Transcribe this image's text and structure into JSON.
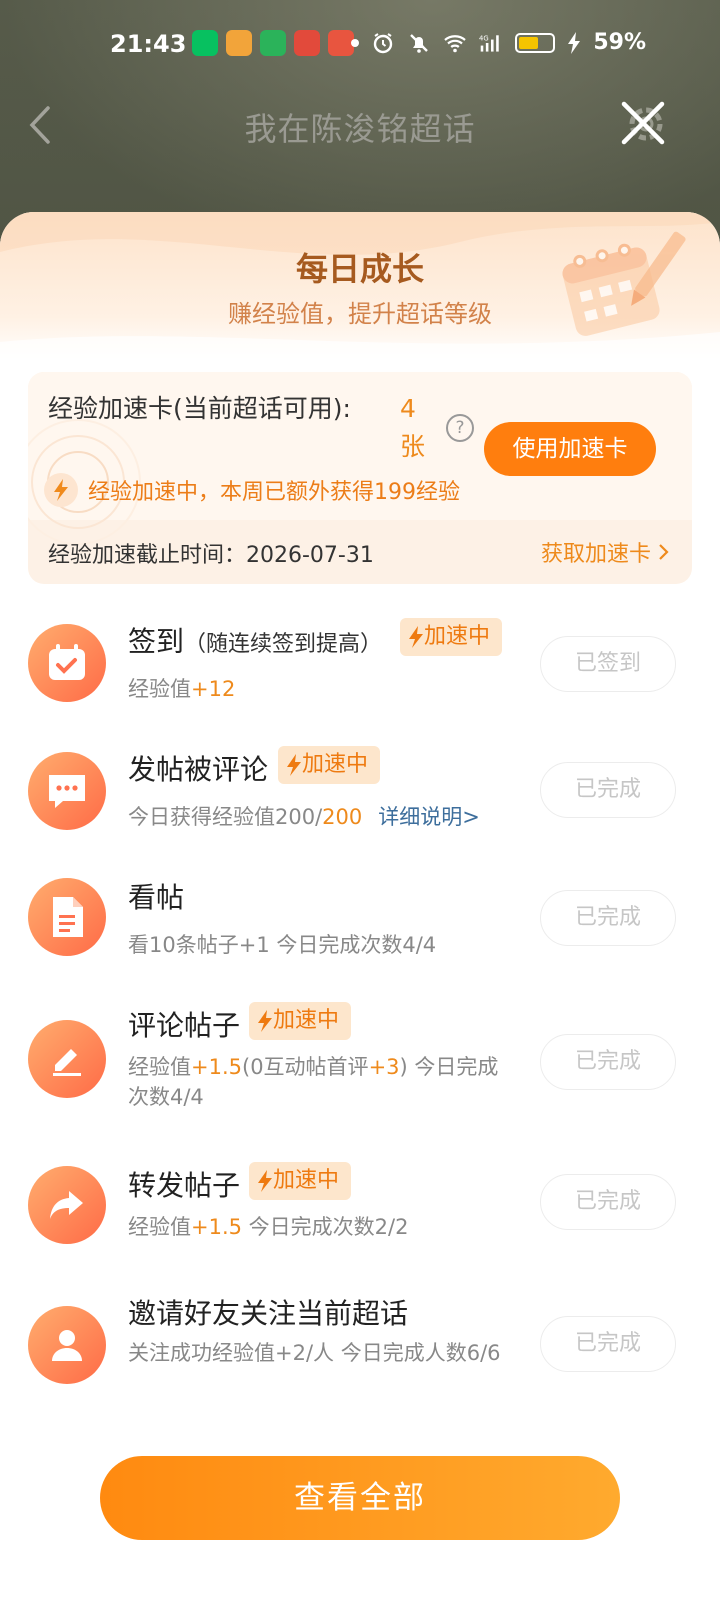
{
  "status_bar": {
    "time": "21:43",
    "battery": "59%",
    "battery_level": 0.59,
    "app_icon_colors": [
      "#07c160",
      "#f2a43a",
      "#2bb35a",
      "#e24a3b",
      "#e8553f"
    ]
  },
  "header": {
    "title": "我在陈浚铭超话"
  },
  "growth": {
    "title": "每日成长",
    "subtitle": "赚经验值，提升超话等级"
  },
  "boost_card": {
    "label": "经验加速卡(当前超话可用):",
    "count": "4张",
    "help_icon": "?",
    "use_button": "使用加速卡",
    "status_text": "经验加速中，本周已额外获得199经验",
    "deadline_text": "经验加速截止时间：2026-07-31",
    "get_card_link": "获取加速卡",
    "accent": "#ff7e0e"
  },
  "tasks": [
    {
      "icon": "calendar-check-icon",
      "title": "签到",
      "title_sub": "（随连续签到提高）",
      "tag": "加速中",
      "desc_prefix": "经验值",
      "desc_hl": "+12",
      "button": "已签到"
    },
    {
      "icon": "comment-icon",
      "title": "发帖被评论",
      "tag": "加速中",
      "desc_prefix": "今日获得经验值200/",
      "desc_hl": "200",
      "desc_link": "详细说明>",
      "button": "已完成"
    },
    {
      "icon": "document-icon",
      "title": "看帖",
      "desc": "看10条帖子+1   今日完成次数4/4",
      "button": "已完成"
    },
    {
      "icon": "pencil-icon",
      "title": "评论帖子",
      "tag": "加速中",
      "desc_prefix": "经验值",
      "desc_hl": "+1.5",
      "desc_mid": "(0互动帖首评",
      "desc_hl2": "+3",
      "desc_suffix": ")   今日完成次数4/4",
      "button": "已完成"
    },
    {
      "icon": "share-arrow-icon",
      "title": "转发帖子",
      "tag": "加速中",
      "desc_prefix": "经验值",
      "desc_hl": "+1.5",
      "desc_suffix": "   今日完成次数2/2",
      "button": "已完成"
    },
    {
      "icon": "user-icon",
      "title": "邀请好友关注当前超话",
      "desc": "关注成功经验值+2/人   今日完成人数6/6",
      "button": "已完成"
    }
  ],
  "view_all_button": "查看全部"
}
